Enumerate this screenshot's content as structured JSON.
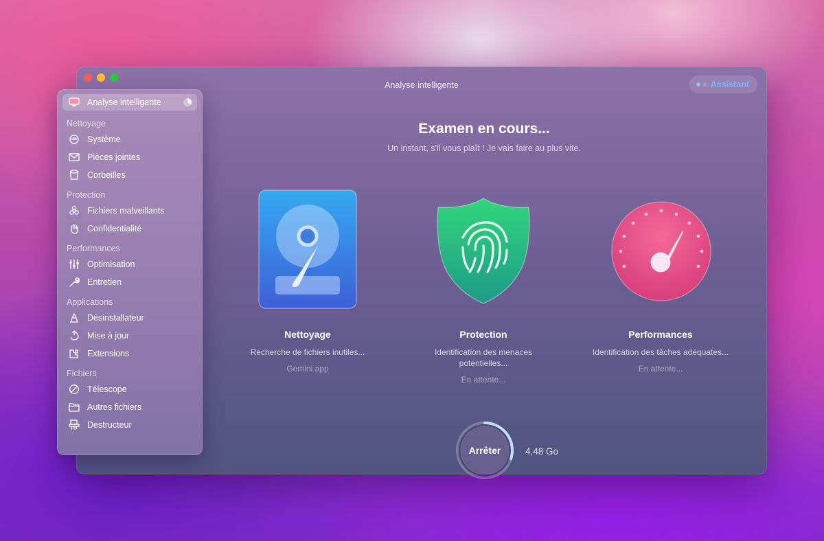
{
  "window": {
    "title": "Analyse intelligente",
    "assistant_label": "Assistant"
  },
  "sidebar": {
    "active_item": {
      "label": "Analyse intelligente",
      "icon": "monitor-icon"
    },
    "sections": [
      {
        "title": "Nettoyage",
        "items": [
          {
            "label": "Système",
            "icon": "hand-icon"
          },
          {
            "label": "Pièces jointes",
            "icon": "envelope-icon"
          },
          {
            "label": "Corbeilles",
            "icon": "trash-bin-icon"
          }
        ]
      },
      {
        "title": "Protection",
        "items": [
          {
            "label": "Fichiers malveillants",
            "icon": "biohazard-icon"
          },
          {
            "label": "Confidentialité",
            "icon": "raised-hand-icon"
          }
        ]
      },
      {
        "title": "Performances",
        "items": [
          {
            "label": "Optimisation",
            "icon": "sliders-icon"
          },
          {
            "label": "Entretien",
            "icon": "wrench-icon"
          }
        ]
      },
      {
        "title": "Applications",
        "items": [
          {
            "label": "Désinstallateur",
            "icon": "uninstaller-icon"
          },
          {
            "label": "Mise à jour",
            "icon": "update-arrow-icon"
          },
          {
            "label": "Extensions",
            "icon": "extensions-icon"
          }
        ]
      },
      {
        "title": "Fichiers",
        "items": [
          {
            "label": "Télescope",
            "icon": "telescope-icon"
          },
          {
            "label": "Autres fichiers",
            "icon": "folder-icon"
          },
          {
            "label": "Destructeur",
            "icon": "shredder-icon"
          }
        ]
      }
    ]
  },
  "main": {
    "title": "Examen en cours...",
    "subtitle": "Un instant, s'il vous plaît ! Je vais faire au plus vite.",
    "modules": [
      {
        "name": "Nettoyage",
        "description": "Recherche de fichiers inutiles...",
        "status": "Gemini.app",
        "icon": "hard-drive-icon"
      },
      {
        "name": "Protection",
        "description": "Identification des menaces potentielles...",
        "status": "En attente...",
        "icon": "fingerprint-shield-icon"
      },
      {
        "name": "Performances",
        "description": "Identification des tâches adéquates...",
        "status": "En attente...",
        "icon": "speedometer-icon"
      }
    ],
    "stop_label": "Arrêter",
    "scanned_size": "4,48 Go",
    "progress_fraction": 0.3
  },
  "colors": {
    "accent_blue": "#7fb0ff",
    "shield_green": "#2fce7a",
    "gauge_pink": "#e8508a",
    "drive_blue": "#3d82e0"
  }
}
